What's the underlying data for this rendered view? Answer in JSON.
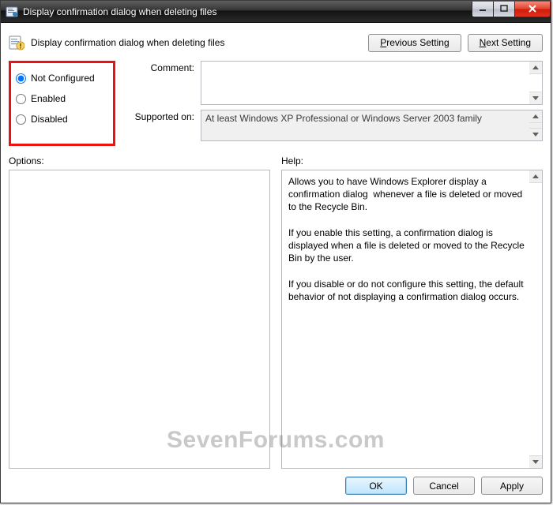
{
  "window": {
    "title": "Display confirmation dialog when deleting files"
  },
  "header": {
    "title": "Display confirmation dialog when deleting files",
    "prev_label": "Previous Setting",
    "next_label": "Next Setting"
  },
  "radios": {
    "not_configured": "Not Configured",
    "enabled": "Enabled",
    "disabled": "Disabled",
    "selected": "not_configured"
  },
  "comment": {
    "label": "Comment:",
    "value": ""
  },
  "supported": {
    "label": "Supported on:",
    "value": "At least Windows XP Professional or Windows Server 2003 family"
  },
  "options": {
    "label": "Options:",
    "value": ""
  },
  "help": {
    "label": "Help:",
    "text": "Allows you to have Windows Explorer display a confirmation dialog  whenever a file is deleted or moved to the Recycle Bin.\n\nIf you enable this setting, a confirmation dialog is displayed when a file is deleted or moved to the Recycle Bin by the user.\n\nIf you disable or do not configure this setting, the default behavior of not displaying a confirmation dialog occurs."
  },
  "footer": {
    "ok": "OK",
    "cancel": "Cancel",
    "apply": "Apply"
  },
  "watermark": "SevenForums.com"
}
